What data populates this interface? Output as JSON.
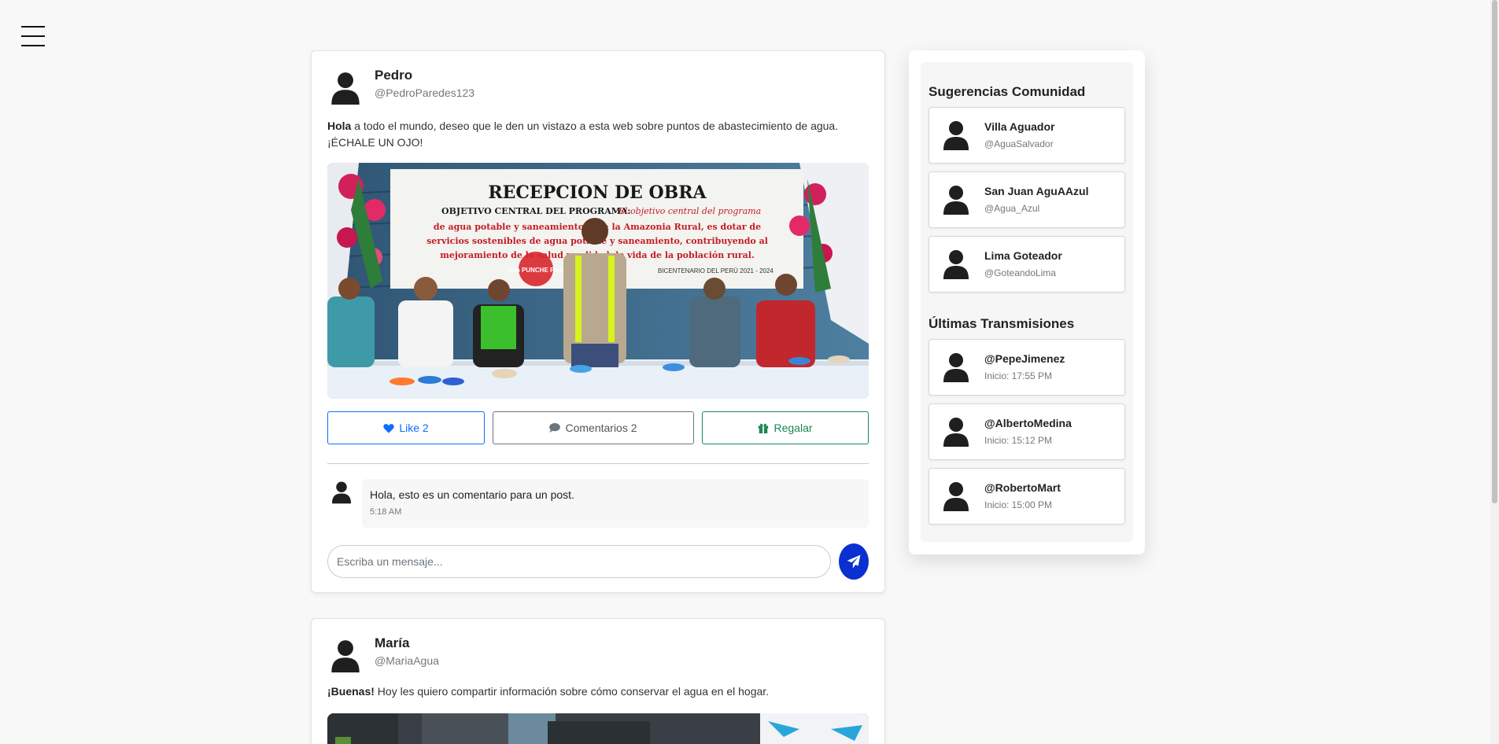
{
  "nav": {
    "menu_icon": "hamburger-icon"
  },
  "posts": [
    {
      "author": "Pedro",
      "handle": "@PedroParedes123",
      "text_bold": "Hola",
      "text": " a todo el mundo, deseo que le den un vistazo a esta web sobre puntos de abastecimiento de agua. ¡ÉCHALE UN OJO!",
      "image": {
        "banner_title": "RECEPCION DE OBRA",
        "banner_line1_bold": "OBJETIVO CENTRAL DEL PROGRAMA:",
        "banner_line1": "El objetivo central del programa",
        "banner_line2": "de agua potable y saneamiento para la Amazonia Rural, es dotar de",
        "banner_line3": "servicios sostenibles de agua potable y saneamiento, contribuyendo al",
        "banner_line4": "mejoramiento de la salud y calidad de vida de la población rural.",
        "bicentenario": "BICENTENARIO DEL PERÚ 2021 - 2024",
        "logo_text": "Con PUNCHE Perú"
      },
      "like_label": "Like 2",
      "comments_label": "Comentarios 2",
      "gift_label": "Regalar",
      "comment": {
        "text": "Hola, esto es un comentario para un post.",
        "time": "5:18 AM"
      },
      "message_placeholder": "Escriba un mensaje..."
    },
    {
      "author": "María",
      "handle": "@MariaAgua",
      "text_bold": "¡Buenas!",
      "text": " Hoy les quiero compartir información sobre cómo conservar el agua en el hogar."
    }
  ],
  "sidebar": {
    "suggestions_title": "Sugerencias Comunidad",
    "suggestions": [
      {
        "name": "Villa Aguador",
        "handle": "@AguaSalvador"
      },
      {
        "name": "San Juan AguAAzul",
        "handle": "@Agua_Azul"
      },
      {
        "name": "Lima Goteador",
        "handle": "@GoteandoLima"
      }
    ],
    "streams_title": "Últimas Transmisiones",
    "streams": [
      {
        "name": "@PepeJimenez",
        "start": "Inicio: 17:55 PM"
      },
      {
        "name": "@AlbertoMedina",
        "start": "Inicio: 15:12 PM"
      },
      {
        "name": "@RobertoMart",
        "start": "Inicio: 15:00 PM"
      }
    ]
  },
  "colors": {
    "like": "#0d6efd",
    "gift": "#198754",
    "send": "#0b2fd1"
  }
}
